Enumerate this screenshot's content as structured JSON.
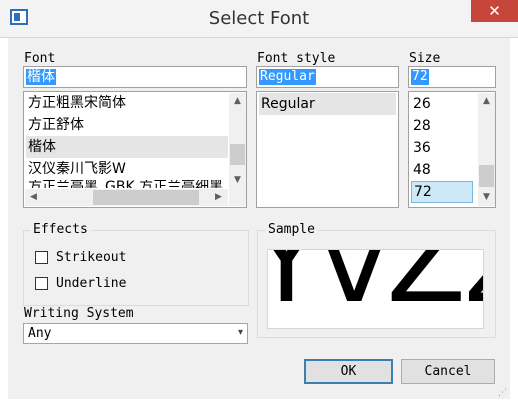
{
  "window": {
    "title": "Select Font",
    "close_glyph": "✕",
    "app_icon": "app-window-icon"
  },
  "font": {
    "label": "Font",
    "value": "楷体",
    "items": [
      "方正粗黑宋简体",
      "方正舒体",
      "楷体",
      "汉仪秦川飞影W",
      "方正兰亭黑_GBK 方正兰亭细黑"
    ]
  },
  "style": {
    "label": "Font style",
    "value": "Regular",
    "items": [
      "Regular"
    ]
  },
  "size": {
    "label": "Size",
    "value": "72",
    "items": [
      "26",
      "28",
      "36",
      "48",
      "72"
    ]
  },
  "effects": {
    "label": "Effects",
    "strikeout": {
      "label": "Strikeout",
      "checked": false
    },
    "underline": {
      "label": "Underline",
      "checked": false
    }
  },
  "writing_system": {
    "label": "Writing System",
    "value": "Any"
  },
  "sample": {
    "label": "Sample",
    "text": "YvZz"
  },
  "buttons": {
    "ok": "OK",
    "cancel": "Cancel"
  },
  "icons": {
    "up": "▲",
    "down": "▼",
    "left": "◀",
    "right": "▶",
    "dropdown": "▾"
  },
  "colors": {
    "selection": "#3399ff",
    "close": "#c7463b",
    "list_selected": "#cde8f7"
  }
}
